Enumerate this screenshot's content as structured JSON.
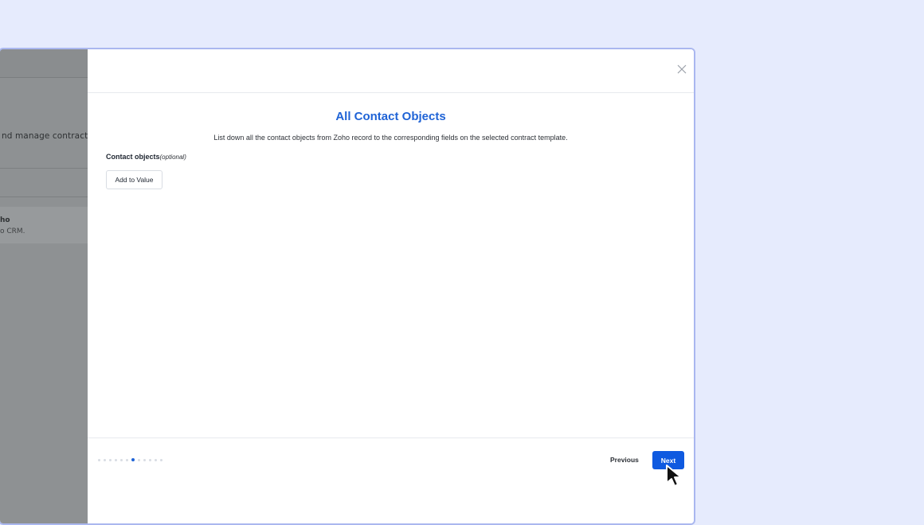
{
  "background_app": {
    "description_text": "nd manage contracts v",
    "card_title": "ho",
    "card_subtitle": "o CRM."
  },
  "modal": {
    "title": "All Contact Objects",
    "description": "List down all the contact objects from Zoho record to the corresponding fields on the selected contract template.",
    "field": {
      "label": "Contact objects",
      "optional_tag": "(optional)"
    },
    "add_button_label": "Add to Value",
    "close_icon": "close-icon"
  },
  "footer": {
    "steps_total": 12,
    "current_step": 7,
    "previous_label": "Previous",
    "next_label": "Next"
  },
  "colors": {
    "accent": "#1f63d6",
    "primary_button": "#0f5ae0",
    "page_background": "#e6ebfd",
    "overlay": "#8e9193"
  }
}
